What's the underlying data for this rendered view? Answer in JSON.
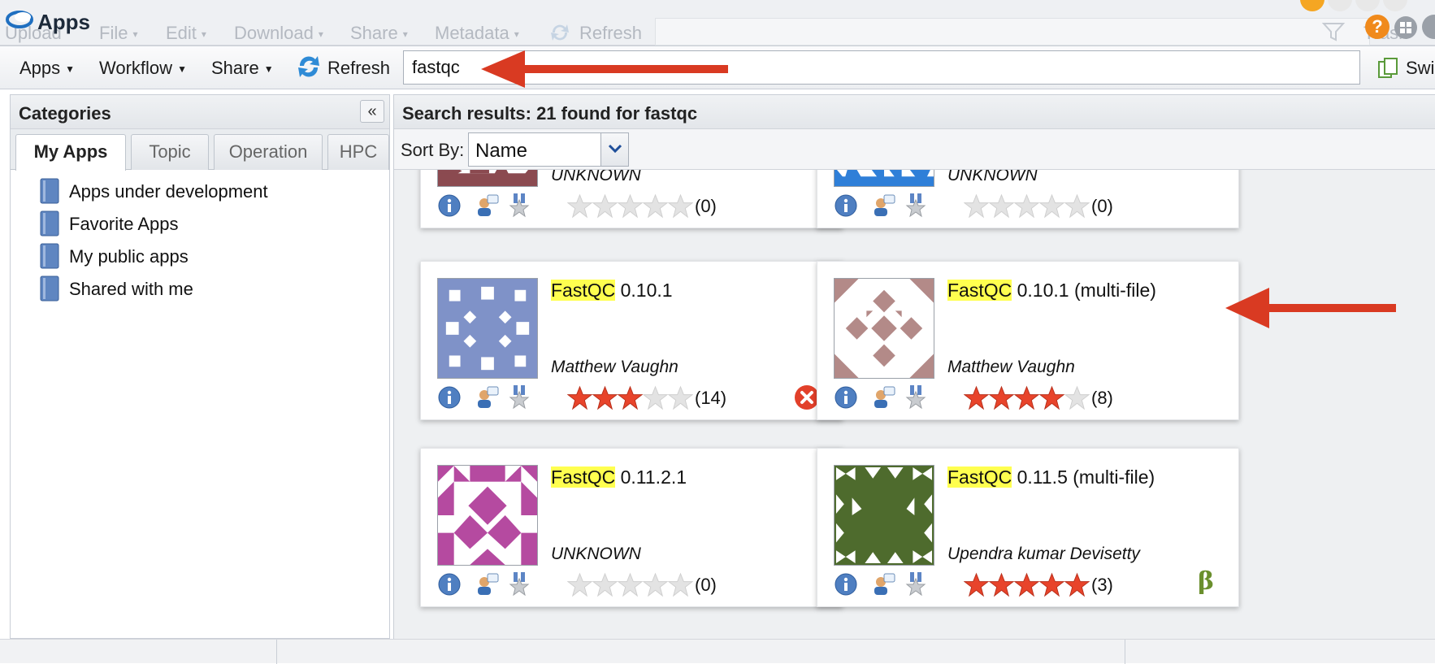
{
  "window": {
    "title": "Apps",
    "bg_menu": [
      "Upload",
      "File",
      "Edit",
      "Download",
      "Share",
      "Metadata",
      "Refresh"
    ],
    "bg_trash": "Trash"
  },
  "toolbar": {
    "apps_label": "Apps",
    "workflow_label": "Workflow",
    "share_label": "Share",
    "refresh_label": "Refresh",
    "search_value": "fastqc",
    "switch_label": "Swi"
  },
  "categories": {
    "title": "Categories",
    "collapse_icon": "double-chevron-left",
    "tabs": [
      {
        "label": "My Apps",
        "active": true
      },
      {
        "label": "Topic",
        "active": false
      },
      {
        "label": "Operation",
        "active": false
      },
      {
        "label": "HPC",
        "active": false
      }
    ],
    "items": [
      {
        "label": "Apps under development",
        "icon": "book-icon"
      },
      {
        "label": "Favorite Apps",
        "icon": "book-icon"
      },
      {
        "label": "My public apps",
        "icon": "book-icon"
      },
      {
        "label": "Shared with me",
        "icon": "book-icon"
      }
    ]
  },
  "results": {
    "title": "Search results: 21 found for fastqc",
    "sort_label": "Sort By:",
    "sort_value": "Name",
    "highlight": "FastQC",
    "cards": [
      {
        "name_hl": "",
        "name_rest": "",
        "author": "UNKNOWN",
        "rating": 0,
        "count": "(0)",
        "thumb_color": "#8b4a50",
        "flag": ""
      },
      {
        "name_hl": "",
        "name_rest": "",
        "author": "UNKNOWN",
        "rating": 0,
        "count": "(0)",
        "thumb_color": "#2f7fd8",
        "flag": ""
      },
      {
        "name_hl": "FastQC",
        "name_rest": " 0.10.1",
        "author": "Matthew Vaughn",
        "rating": 3,
        "count": "(14)",
        "thumb_color": "#7f92c8",
        "flag": "error"
      },
      {
        "name_hl": "FastQC",
        "name_rest": " 0.10.1 (multi-file)",
        "author": "Matthew Vaughn",
        "rating": 4,
        "count": "(8)",
        "thumb_color": "#b38a88",
        "flag": ""
      },
      {
        "name_hl": "FastQC",
        "name_rest": " 0.11.2.1",
        "author": "UNKNOWN",
        "rating": 0,
        "count": "(0)",
        "thumb_color": "#b54aa0",
        "flag": ""
      },
      {
        "name_hl": "FastQC",
        "name_rest": " 0.11.5 (multi-file)",
        "author": "Upendra kumar Devisetty",
        "rating": 5,
        "count": "(3)",
        "thumb_color": "#4e6b2d",
        "flag": "beta"
      }
    ],
    "beta_symbol": "β"
  },
  "colors": {
    "star_filled": "#e8442b",
    "star_empty": "#e3e3e3",
    "highlight": "#ffff4f",
    "arrow": "#d93a22"
  }
}
